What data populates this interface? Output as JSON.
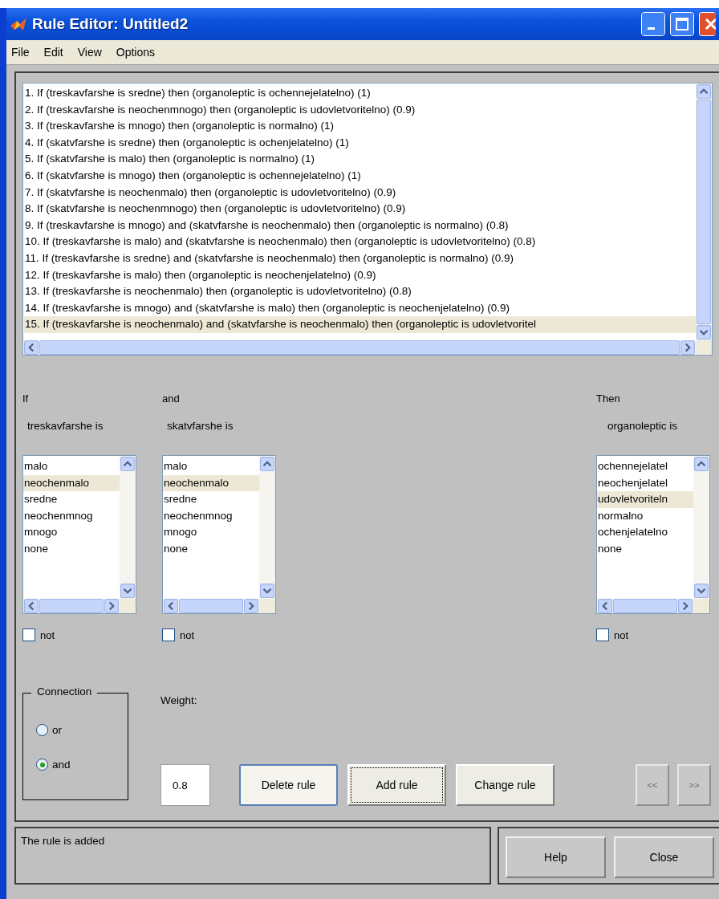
{
  "window": {
    "title": "Rule Editor: Untitled2"
  },
  "menu": [
    "File",
    "Edit",
    "View",
    "Options"
  ],
  "rules": [
    {
      "text": "1. If (treskavfarshe is sredne) then (organoleptic is ochennejelatelno) (1)",
      "selected": false
    },
    {
      "text": "2. If (treskavfarshe is neochenmnogo) then (organoleptic is udovletvoritelno) (0.9)",
      "selected": false
    },
    {
      "text": "3. If (treskavfarshe is mnogo) then (organoleptic is normalno) (1)",
      "selected": false
    },
    {
      "text": "4. If (skatvfarshe is sredne) then (organoleptic is ochenjelatelno) (1)",
      "selected": false
    },
    {
      "text": "5. If (skatvfarshe is malo) then (organoleptic is normalno) (1)",
      "selected": false
    },
    {
      "text": "6. If (skatvfarshe is mnogo) then (organoleptic is ochennejelatelno) (1)",
      "selected": false
    },
    {
      "text": "7. If (skatvfarshe is neochenmalo) then (organoleptic is udovletvoritelno) (0.9)",
      "selected": false
    },
    {
      "text": "8. If (skatvfarshe is neochenmnogo) then (organoleptic is udovletvoritelno) (0.9)",
      "selected": false
    },
    {
      "text": "9. If (treskavfarshe is mnogo) and (skatvfarshe is neochenmalo) then (organoleptic is normalno) (0.8)",
      "selected": false
    },
    {
      "text": "10. If (treskavfarshe is malo) and (skatvfarshe is neochenmalo) then (organoleptic is udovletvoritelno) (0.8)",
      "selected": false
    },
    {
      "text": "11. If (treskavfarshe is sredne) and (skatvfarshe is neochenmalo) then (organoleptic is normalno) (0.9)",
      "selected": false
    },
    {
      "text": "12. If (treskavfarshe is malo) then (organoleptic is neochenjelatelno) (0.9)",
      "selected": false
    },
    {
      "text": "13. If (treskavfarshe is neochenmalo) then (organoleptic is udovletvoritelno) (0.8)",
      "selected": false
    },
    {
      "text": "14. If (treskavfarshe is mnogo) and (skatvfarshe is malo) then (organoleptic is neochenjelatelno) (0.9)",
      "selected": false
    },
    {
      "text": "15. If (treskavfarshe is neochenmalo) and (skatvfarshe is neochenmalo) then (organoleptic is udovletvoritel",
      "selected": true
    }
  ],
  "columns": [
    {
      "connector": "If",
      "variable": "treskavfarshe is",
      "not_label": "not",
      "not": false,
      "items": [
        {
          "label": "malo",
          "selected": false
        },
        {
          "label": "neochenmalo",
          "selected": true
        },
        {
          "label": "sredne",
          "selected": false
        },
        {
          "label": "neochenmnog",
          "selected": false
        },
        {
          "label": "mnogo",
          "selected": false
        },
        {
          "label": "none",
          "selected": false
        }
      ]
    },
    {
      "connector": "and",
      "variable": "skatvfarshe is",
      "not_label": "not",
      "not": false,
      "items": [
        {
          "label": "malo",
          "selected": false
        },
        {
          "label": "neochenmalo",
          "selected": true
        },
        {
          "label": "sredne",
          "selected": false
        },
        {
          "label": "neochenmnog",
          "selected": false
        },
        {
          "label": "mnogo",
          "selected": false
        },
        {
          "label": "none",
          "selected": false
        }
      ]
    },
    {
      "connector": "Then",
      "variable": "organoleptic is",
      "not_label": "not",
      "not": false,
      "items": [
        {
          "label": "ochennejelatel",
          "selected": false
        },
        {
          "label": "neochenjelatel",
          "selected": false
        },
        {
          "label": "udovletvoriteln",
          "selected": true
        },
        {
          "label": "normalno",
          "selected": false
        },
        {
          "label": "ochenjelatelno",
          "selected": false
        },
        {
          "label": "none",
          "selected": false
        }
      ]
    }
  ],
  "connection": {
    "title": "Connection",
    "options": [
      {
        "label": "or",
        "selected": false
      },
      {
        "label": "and",
        "selected": true
      }
    ]
  },
  "weight": {
    "label": "Weight:",
    "value": "0.8"
  },
  "buttons": [
    {
      "label": "Delete rule",
      "default": true,
      "focused": false
    },
    {
      "label": "Add rule",
      "default": false,
      "focused": true
    },
    {
      "label": "Change rule",
      "default": false,
      "focused": false
    }
  ],
  "nav_buttons": [
    {
      "label": "<<",
      "disabled": true
    },
    {
      "label": ">>",
      "disabled": true
    }
  ],
  "status": "The rule is added",
  "footer_buttons": [
    "Help",
    "Close"
  ]
}
